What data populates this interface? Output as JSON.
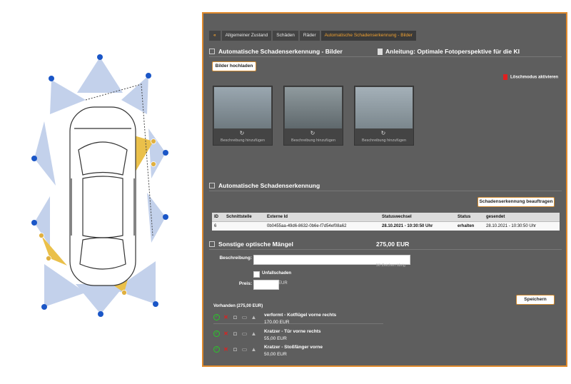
{
  "diagram": {
    "markers": [
      "e1",
      "e2",
      "c1",
      "c2",
      "c3",
      "c4",
      "c5",
      "c6",
      "c7",
      "c8",
      "c9"
    ],
    "accent": "#1a56c7",
    "cone_blue": "#b9c9e8",
    "cone_yellow": "#eac04a"
  },
  "modal": {
    "close_icon": "close-icon",
    "tabs": [
      {
        "label": "«"
      },
      {
        "label": "Allgemeiner Zustand"
      },
      {
        "label": "Schäden"
      },
      {
        "label": "Räder"
      },
      {
        "label": "Automatische Schadenserkennung - Bilder"
      }
    ],
    "section1": {
      "title": "Automatische Schadenserkennung - Bilder",
      "guide_link": "Anleitung: Optimale Fotoperspektive für die KI",
      "upload_button": "Bilder hochladen",
      "delete_mode": "Löschmodus aktivieren",
      "photos": [
        {
          "caption": "Beschreibung hinzufügen"
        },
        {
          "caption": "Beschreibung hinzufügen"
        },
        {
          "caption": "Beschreibung hinzufügen"
        }
      ]
    },
    "section2": {
      "title": "Automatische Schadenserkennung",
      "order_button": "Schadenserkennung beauftragen",
      "table": {
        "headers": [
          "ID",
          "Schnittstelle",
          "Externe Id",
          "Statuswechsel",
          "Status",
          "gesendet"
        ],
        "rows": [
          [
            "6",
            "",
            "0b0455aa-49d6-8632-0b6e-f7d54ef08a62",
            "28.10.2021 - 10:30:50 Uhr",
            "erhalten",
            "28.10.2021 - 10:30:50 Uhr"
          ]
        ]
      }
    },
    "section3": {
      "title": "Sonstige optische Mängel",
      "amount": "275,00 EUR",
      "desc_label": "Beschreibung:",
      "desc_value": "",
      "char_hint": "50 Zeichen übrig",
      "accident_label": "Unfallschaden",
      "price_label": "Preis:",
      "price_value": "",
      "currency": "EUR",
      "save_button": "Speichern",
      "present_label": "Vorhanden (275,00 EUR)",
      "items": [
        {
          "title": "verformt - Kotflügel vorne rechts",
          "price": "170,00 EUR"
        },
        {
          "title": "Kratzer - Tür vorne rechts",
          "price": "55,00 EUR"
        },
        {
          "title": "Kratzer - Stoßfänger vorne",
          "price": "50,00 EUR"
        }
      ]
    }
  }
}
